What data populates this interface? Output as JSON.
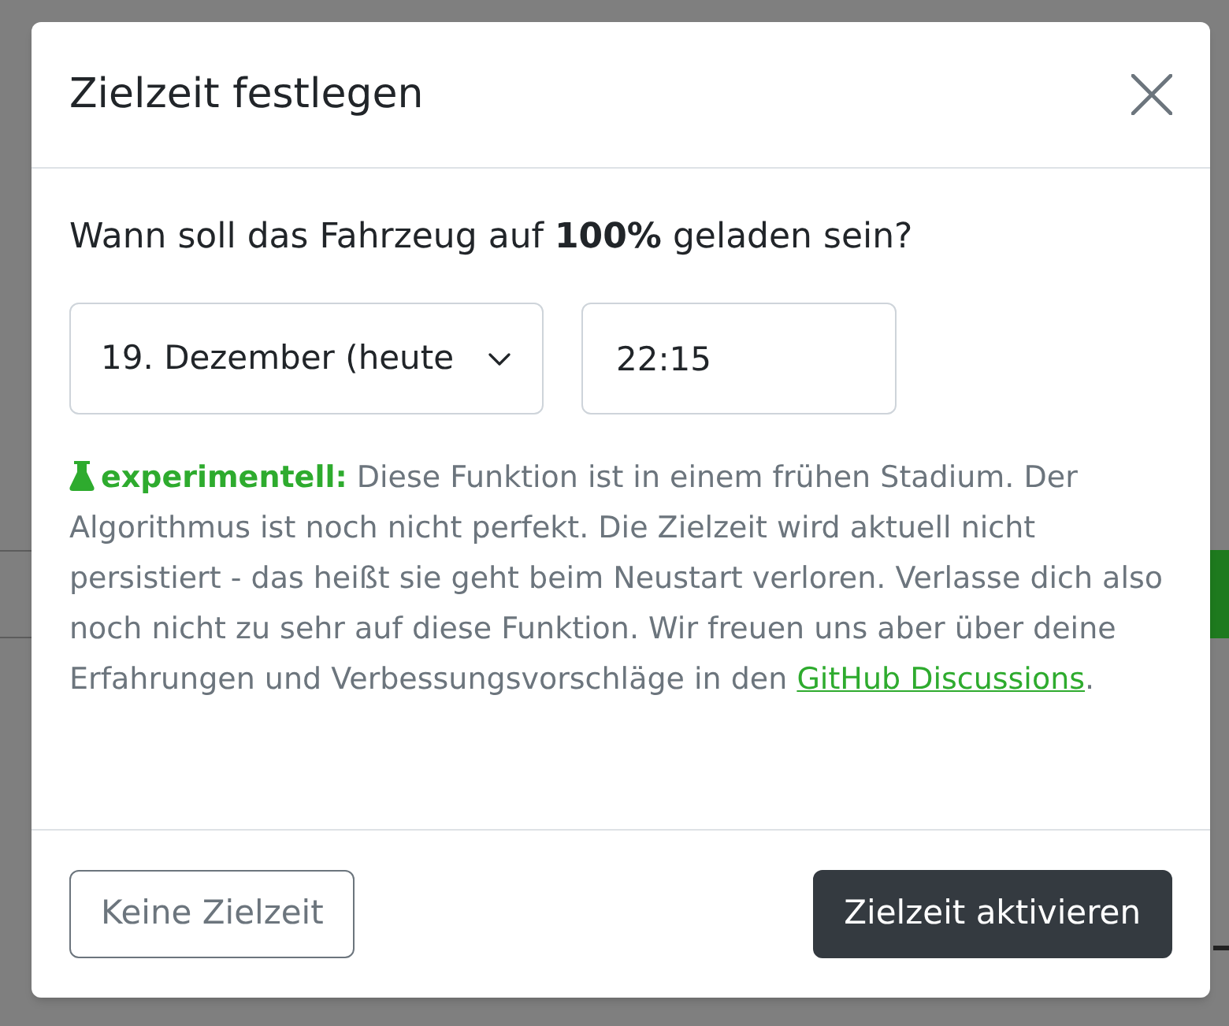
{
  "dialog": {
    "title": "Zielzeit festlegen"
  },
  "question": "Wann soll das Fahrzeug auf **100%** geladen sein?",
  "date_select": {
    "value": "19. Dezember (heute"
  },
  "time_input": {
    "value": "22:15"
  },
  "notice": {
    "label": "experimentell:",
    "text": "Diese Funktion ist in einem frühen Stadium. Der Algorithmus ist noch nicht perfekt. Die Zielzeit wird aktuell nicht persistiert - das heißt sie geht beim Neustart verloren. Verlasse dich also noch nicht zu sehr auf diese Funktion. Wir freuen uns aber über deine Erfahrungen und Verbessungsvorschläge in den",
    "link": "GitHub Discussions",
    "after": "."
  },
  "buttons": [
    {
      "label": "Keine Zielzeit",
      "kind": "outline"
    },
    {
      "label": "Zielzeit aktivieren",
      "kind": "primary"
    }
  ]
}
